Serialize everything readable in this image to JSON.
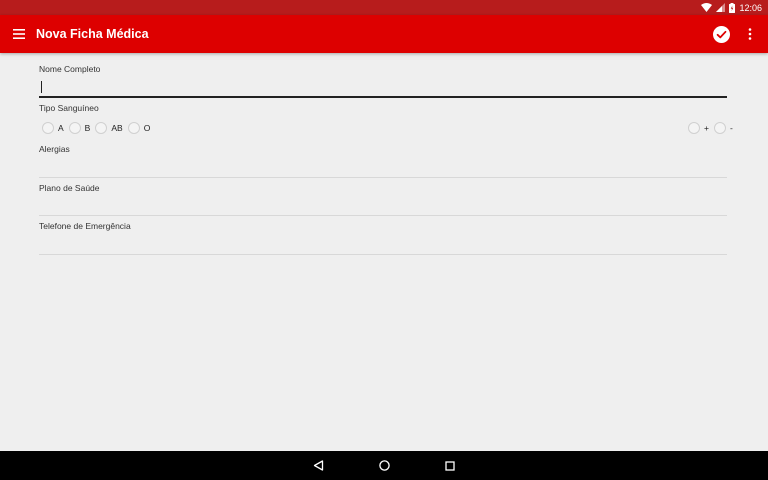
{
  "status_bar": {
    "time": "12:06"
  },
  "app_bar": {
    "title": "Nova Ficha Médica"
  },
  "form": {
    "full_name": {
      "label": "Nome Completo",
      "value": ""
    },
    "blood_type": {
      "label": "Tipo Sanguíneo",
      "groups": [
        "A",
        "B",
        "AB",
        "O"
      ],
      "rh": [
        "+",
        "-"
      ]
    },
    "allergies": {
      "label": "Alergias",
      "value": ""
    },
    "health_plan": {
      "label": "Plano de Saúde",
      "value": ""
    },
    "emergency_phone": {
      "label": "Telefone de Emergência",
      "value": ""
    }
  },
  "icons": {
    "menu": "hamburger-icon",
    "confirm": "check-circle-icon",
    "overflow": "more-vert-icon",
    "back": "back-triangle-icon",
    "home": "home-circle-icon",
    "recents": "recents-square-icon"
  },
  "colors": {
    "primary": "#dd0000",
    "primary_dark": "#b71c1c",
    "background": "#efefef"
  }
}
